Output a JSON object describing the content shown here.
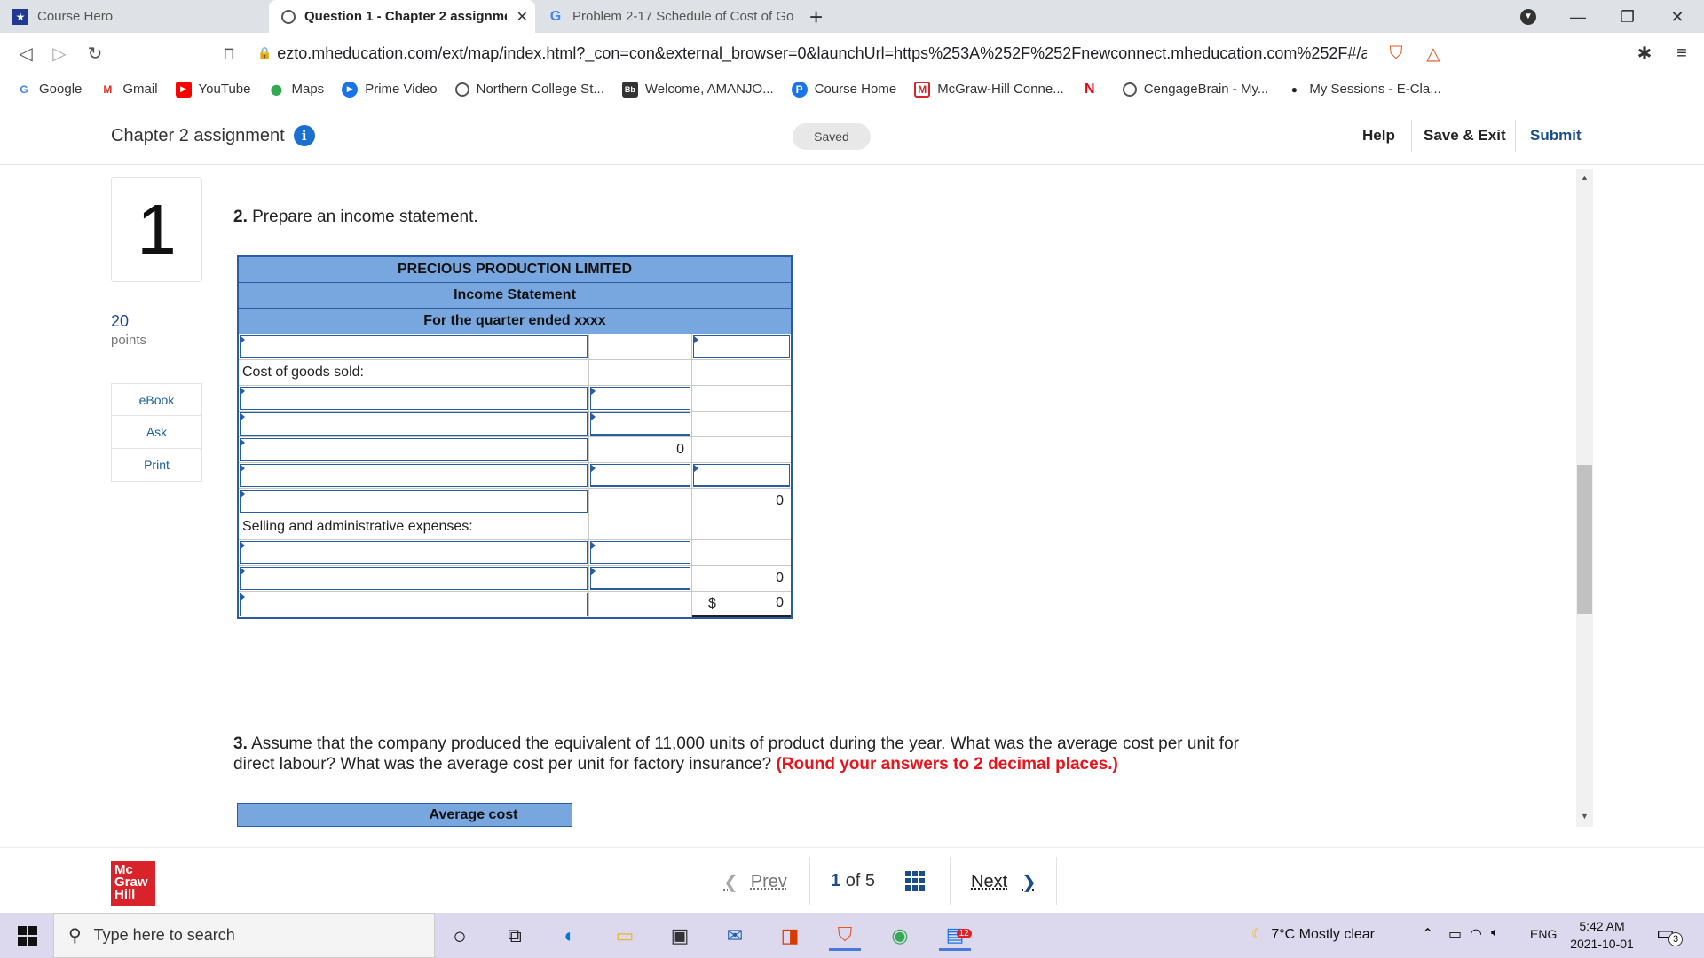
{
  "browser": {
    "tabs": [
      {
        "label": "Course Hero",
        "active": false
      },
      {
        "label": "Question 1 - Chapter 2 assignmen",
        "active": true
      },
      {
        "label": "Problem 2-17 Schedule of Cost of Goo",
        "active": false
      }
    ],
    "new_tab": "+",
    "url": "ezto.mheducation.com/ext/map/index.html?_con=con&external_browser=0&launchUrl=https%253A%252F%252Fnewconnect.mheducation.com%252F#/a...",
    "bookmarks": [
      {
        "label": "Google"
      },
      {
        "label": "Gmail"
      },
      {
        "label": "YouTube"
      },
      {
        "label": "Maps"
      },
      {
        "label": "Prime Video"
      },
      {
        "label": "Northern College St..."
      },
      {
        "label": "Welcome, AMANJO..."
      },
      {
        "label": "Course Home"
      },
      {
        "label": "McGraw-Hill Conne..."
      },
      {
        "label": "CengageBrain - My..."
      },
      {
        "label": "My Sessions - E-Cla..."
      }
    ]
  },
  "header": {
    "title": "Chapter 2 assignment",
    "saved": "Saved",
    "help": "Help",
    "save_exit": "Save & Exit",
    "submit": "Submit"
  },
  "sidebar": {
    "question_number": "1",
    "points_value": "20",
    "points_label": "points",
    "buttons": [
      {
        "label": "eBook"
      },
      {
        "label": "Ask"
      },
      {
        "label": "Print"
      }
    ]
  },
  "question2": {
    "number": "2.",
    "text": " Prepare an income statement."
  },
  "statement": {
    "company": "PRECIOUS PRODUCTION LIMITED",
    "title": "Income Statement",
    "period": "For the quarter ended xxxx",
    "cogs_label": "Cost of goods sold:",
    "cogs_subtotal": "0",
    "gross_value": "0",
    "sae_label": "Selling and administrative expenses:",
    "sae_total": "0",
    "currency": "$",
    "net_value": "0"
  },
  "question3": {
    "number": "3.",
    "text": " Assume that the company produced the equivalent of 11,000 units of product during the year. What was the average cost per unit for direct labour? What was the average cost per unit for factory insurance? ",
    "instruction": "(Round your answers to 2 decimal places.)"
  },
  "avg_table": {
    "header": "Average cost"
  },
  "footer": {
    "logo_line1": "Mc",
    "logo_line2": "Graw",
    "logo_line3": "Hill",
    "prev": "Prev",
    "page_current": "1",
    "page_of": "of 5",
    "next": "Next"
  },
  "taskbar": {
    "search_placeholder": "Type here to search",
    "weather": "7°C  Mostly clear",
    "lang": "ENG",
    "time": "5:42 AM",
    "date": "2021-10-01",
    "notifications": "3",
    "badge_count": "12"
  }
}
